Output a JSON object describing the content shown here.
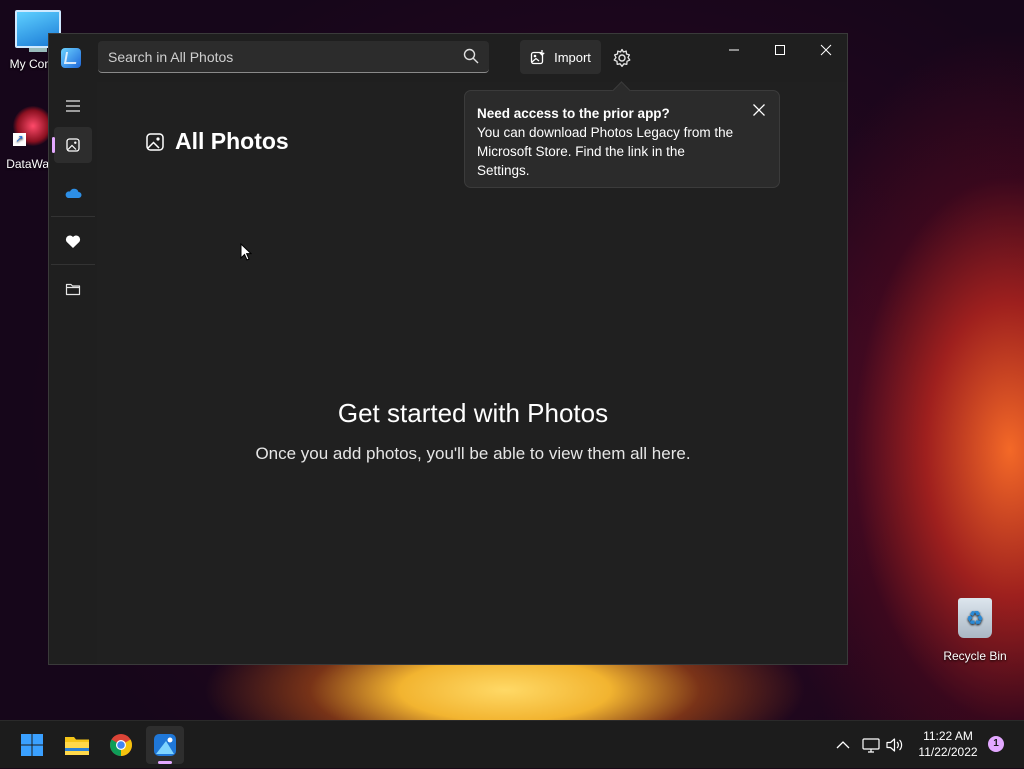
{
  "desktop": {
    "icons": [
      {
        "label": "My Com"
      },
      {
        "label": "DataWag"
      },
      {
        "label": "Recycle Bin"
      }
    ]
  },
  "window": {
    "search": {
      "placeholder": "Search in All Photos"
    },
    "toolbar": {
      "import_label": "Import"
    },
    "nav": {
      "items": [
        "menu-icon",
        "all-photos-icon",
        "onedrive-icon",
        "favorites-icon",
        "folders-icon"
      ]
    },
    "page_title": "All Photos",
    "empty_state": {
      "title": "Get started with Photos",
      "subtitle": "Once you add photos, you'll be able to view them all here."
    },
    "teaching_tip": {
      "title": "Need access to the prior app?",
      "body": "You can download Photos Legacy from the Microsoft Store. Find the link in the Settings."
    }
  },
  "taskbar": {
    "apps": [
      "start-icon",
      "file-explorer-icon",
      "chrome-icon",
      "photos-icon"
    ],
    "clock": {
      "time": "11:22 AM",
      "date": "11/22/2022"
    },
    "notification_count": "1"
  },
  "colors": {
    "accent": "#e3a8ff",
    "window_bg": "#202020",
    "tip_bg": "#2b2b2b"
  }
}
